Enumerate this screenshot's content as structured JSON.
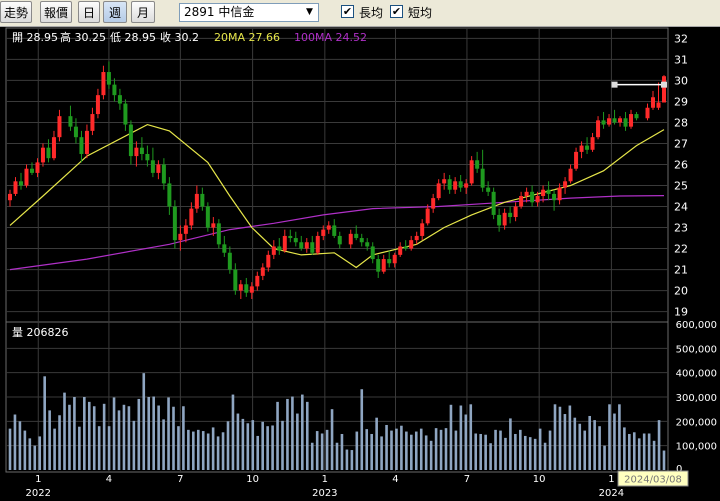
{
  "toolbar": {
    "buttons": [
      {
        "label": "走勢",
        "active": false
      },
      {
        "label": "報價",
        "active": false
      },
      {
        "label": "日",
        "active": false
      },
      {
        "label": "週",
        "active": true
      },
      {
        "label": "月",
        "active": false
      }
    ],
    "stock_select": "2891 中信金",
    "checkboxes": [
      {
        "label": "長均",
        "checked": true
      },
      {
        "label": "短均",
        "checked": true
      }
    ]
  },
  "colors": {
    "up": "#ff2a2a",
    "down": "#1f9a1f",
    "ma20": "#e6e64a",
    "ma100": "#b030c8",
    "volume": "#8fa6c2",
    "grid": "#3a3a3a",
    "highlight": "#ffffc0"
  },
  "info": {
    "open": "開 28.95",
    "high": "高 30.25",
    "low": "低 28.95",
    "close": "收 30.2",
    "ma20": "20MA 27.66",
    "ma100": "100MA 24.52"
  },
  "volume_label": "量 206826",
  "chart_data": [
    {
      "type": "candlestick",
      "title": "",
      "ylim": [
        18.6,
        32.4
      ],
      "y_ticks": [
        19,
        20,
        21,
        22,
        23,
        24,
        25,
        26,
        27,
        28,
        29,
        30,
        31,
        32
      ],
      "grid": true,
      "series": [
        {
          "name": "20MA",
          "values_by_date": [
            [
              "2021-11-26",
              23.1
            ],
            [
              "2022-01-07",
              24.5
            ],
            [
              "2022-03-04",
              26.4
            ],
            [
              "2022-05-20",
              27.9
            ],
            [
              "2022-06-17",
              27.6
            ],
            [
              "2022-08-05",
              26.1
            ],
            [
              "2022-09-02",
              24.5
            ],
            [
              "2022-09-30",
              23.0
            ],
            [
              "2022-10-28",
              22.0
            ],
            [
              "2022-12-02",
              21.7
            ],
            [
              "2023-01-13",
              21.8
            ],
            [
              "2023-02-10",
              21.1
            ],
            [
              "2023-03-03",
              21.7
            ],
            [
              "2023-04-28",
              22.2
            ],
            [
              "2023-06-02",
              23.0
            ],
            [
              "2023-07-07",
              23.6
            ],
            [
              "2023-08-18",
              24.2
            ],
            [
              "2023-09-29",
              24.6
            ],
            [
              "2023-11-10",
              25.0
            ],
            [
              "2023-12-22",
              25.7
            ],
            [
              "2024-02-02",
              26.9
            ],
            [
              "2024-03-08",
              27.66
            ]
          ]
        },
        {
          "name": "100MA",
          "values_by_date": [
            [
              "2021-11-26",
              21.0
            ],
            [
              "2022-03-04",
              21.5
            ],
            [
              "2022-06-17",
              22.2
            ],
            [
              "2022-09-02",
              22.9
            ],
            [
              "2022-10-28",
              23.2
            ],
            [
              "2022-12-30",
              23.6
            ],
            [
              "2023-03-03",
              23.9
            ],
            [
              "2023-05-26",
              24.0
            ],
            [
              "2023-08-18",
              24.2
            ],
            [
              "2023-11-10",
              24.4
            ],
            [
              "2024-01-12",
              24.5
            ],
            [
              "2024-03-08",
              24.52
            ]
          ]
        }
      ],
      "candles": [
        [
          "2021-11-26",
          24.3,
          24.8,
          24.0,
          24.6
        ],
        [
          "2021-12-03",
          24.6,
          25.4,
          24.5,
          25.2
        ],
        [
          "2021-12-10",
          25.2,
          25.6,
          24.8,
          25.0
        ],
        [
          "2021-12-17",
          25.0,
          26.0,
          24.9,
          25.8
        ],
        [
          "2021-12-24",
          25.8,
          26.1,
          25.5,
          25.6
        ],
        [
          "2021-12-31",
          25.6,
          26.3,
          25.4,
          26.1
        ],
        [
          "2022-01-07",
          26.1,
          27.0,
          25.9,
          26.8
        ],
        [
          "2022-01-14",
          26.8,
          27.2,
          26.1,
          26.3
        ],
        [
          "2022-01-21",
          26.3,
          27.6,
          26.2,
          27.3
        ],
        [
          "2022-01-28",
          27.3,
          28.6,
          27.1,
          28.3
        ],
        [
          "2022-02-11",
          28.3,
          28.8,
          27.6,
          27.8
        ],
        [
          "2022-02-18",
          27.8,
          28.2,
          27.0,
          27.3
        ],
        [
          "2022-02-25",
          27.3,
          27.6,
          26.1,
          26.5
        ],
        [
          "2022-03-04",
          26.5,
          27.9,
          26.3,
          27.6
        ],
        [
          "2022-03-11",
          27.6,
          28.7,
          27.4,
          28.4
        ],
        [
          "2022-03-18",
          28.4,
          29.6,
          28.2,
          29.3
        ],
        [
          "2022-03-25",
          29.3,
          30.7,
          29.1,
          30.4
        ],
        [
          "2022-04-01",
          30.4,
          30.9,
          29.6,
          29.8
        ],
        [
          "2022-04-08",
          29.8,
          30.1,
          29.0,
          29.3
        ],
        [
          "2022-04-15",
          29.3,
          29.6,
          28.6,
          28.9
        ],
        [
          "2022-04-22",
          28.9,
          29.1,
          27.6,
          27.9
        ],
        [
          "2022-04-29",
          27.9,
          28.1,
          26.0,
          26.4
        ],
        [
          "2022-05-06",
          26.4,
          27.1,
          25.9,
          26.8
        ],
        [
          "2022-05-13",
          26.8,
          27.3,
          26.2,
          26.5
        ],
        [
          "2022-05-20",
          26.5,
          26.9,
          25.9,
          26.2
        ],
        [
          "2022-05-27",
          26.2,
          26.8,
          25.4,
          25.6
        ],
        [
          "2022-06-03",
          25.6,
          26.2,
          25.3,
          26.0
        ],
        [
          "2022-06-10",
          26.0,
          26.3,
          24.8,
          25.1
        ],
        [
          "2022-06-17",
          25.1,
          25.4,
          23.6,
          24.0
        ],
        [
          "2022-06-24",
          24.0,
          24.3,
          22.0,
          22.4
        ],
        [
          "2022-07-01",
          22.4,
          23.1,
          21.9,
          22.7
        ],
        [
          "2022-07-08",
          22.7,
          23.4,
          22.3,
          23.1
        ],
        [
          "2022-07-15",
          23.1,
          24.2,
          22.9,
          23.9
        ],
        [
          "2022-07-22",
          23.9,
          25.0,
          23.7,
          24.6
        ],
        [
          "2022-07-29",
          24.6,
          24.9,
          23.8,
          24.0
        ],
        [
          "2022-08-05",
          24.0,
          24.2,
          22.8,
          23.0
        ],
        [
          "2022-08-12",
          23.0,
          23.5,
          22.6,
          23.2
        ],
        [
          "2022-08-19",
          23.2,
          23.4,
          22.0,
          22.2
        ],
        [
          "2022-08-26",
          22.2,
          22.6,
          21.6,
          21.8
        ],
        [
          "2022-09-02",
          21.8,
          22.1,
          20.8,
          21.0
        ],
        [
          "2022-09-09",
          21.0,
          21.3,
          19.8,
          20.0
        ],
        [
          "2022-09-16",
          20.0,
          20.5,
          19.6,
          20.3
        ],
        [
          "2022-09-23",
          20.3,
          20.6,
          19.7,
          19.9
        ],
        [
          "2022-09-30",
          19.9,
          20.4,
          19.6,
          20.2
        ],
        [
          "2022-10-07",
          20.2,
          20.9,
          20.0,
          20.7
        ],
        [
          "2022-10-14",
          20.7,
          21.3,
          20.5,
          21.1
        ],
        [
          "2022-10-21",
          21.1,
          21.9,
          20.9,
          21.7
        ],
        [
          "2022-10-28",
          21.7,
          22.4,
          21.5,
          22.1
        ],
        [
          "2022-11-04",
          22.1,
          22.5,
          21.7,
          21.9
        ],
        [
          "2022-11-11",
          21.9,
          22.9,
          21.8,
          22.6
        ],
        [
          "2022-11-18",
          22.6,
          22.9,
          22.3,
          22.5
        ],
        [
          "2022-11-25",
          22.5,
          22.8,
          22.1,
          22.3
        ],
        [
          "2022-12-02",
          22.3,
          22.6,
          21.9,
          22.0
        ],
        [
          "2022-12-09",
          22.0,
          22.5,
          21.8,
          22.3
        ],
        [
          "2022-12-16",
          22.3,
          22.6,
          21.7,
          21.8
        ],
        [
          "2022-12-23",
          21.8,
          22.8,
          21.7,
          22.6
        ],
        [
          "2022-12-30",
          22.6,
          23.1,
          22.4,
          22.9
        ],
        [
          "2023-01-06",
          22.9,
          23.3,
          22.7,
          23.1
        ],
        [
          "2023-01-13",
          23.1,
          23.4,
          22.5,
          22.6
        ],
        [
          "2023-01-20",
          22.6,
          22.8,
          22.0,
          22.2
        ],
        [
          "2023-02-03",
          22.2,
          22.9,
          22.0,
          22.7
        ],
        [
          "2023-02-10",
          22.7,
          23.1,
          22.4,
          22.5
        ],
        [
          "2023-02-17",
          22.5,
          22.7,
          22.1,
          22.3
        ],
        [
          "2023-02-24",
          22.3,
          22.5,
          21.9,
          22.1
        ],
        [
          "2023-03-03",
          22.1,
          22.3,
          21.3,
          21.5
        ],
        [
          "2023-03-10",
          21.5,
          21.7,
          20.6,
          20.9
        ],
        [
          "2023-03-17",
          20.9,
          21.7,
          20.8,
          21.5
        ],
        [
          "2023-03-24",
          21.5,
          21.9,
          21.1,
          21.3
        ],
        [
          "2023-03-31",
          21.3,
          21.8,
          21.1,
          21.7
        ],
        [
          "2023-04-07",
          21.7,
          22.3,
          21.6,
          22.1
        ],
        [
          "2023-04-14",
          22.1,
          22.4,
          21.9,
          22.0
        ],
        [
          "2023-04-21",
          22.0,
          22.6,
          21.9,
          22.4
        ],
        [
          "2023-04-28",
          22.4,
          22.8,
          22.2,
          22.6
        ],
        [
          "2023-05-05",
          22.6,
          23.4,
          22.4,
          23.2
        ],
        [
          "2023-05-12",
          23.2,
          24.1,
          23.1,
          23.9
        ],
        [
          "2023-05-19",
          23.9,
          24.6,
          23.7,
          24.4
        ],
        [
          "2023-05-26",
          24.4,
          25.3,
          24.3,
          25.1
        ],
        [
          "2023-06-02",
          25.1,
          25.6,
          24.8,
          25.3
        ],
        [
          "2023-06-09",
          25.3,
          25.5,
          24.6,
          24.8
        ],
        [
          "2023-06-16",
          24.8,
          25.4,
          24.6,
          25.2
        ],
        [
          "2023-06-23",
          25.2,
          25.5,
          24.7,
          24.9
        ],
        [
          "2023-06-30",
          24.9,
          25.3,
          24.6,
          25.1
        ],
        [
          "2023-07-07",
          25.1,
          26.4,
          25.0,
          26.2
        ],
        [
          "2023-07-14",
          26.2,
          26.6,
          25.6,
          25.8
        ],
        [
          "2023-07-21",
          25.8,
          26.7,
          24.7,
          24.9
        ],
        [
          "2023-07-28",
          24.9,
          25.2,
          24.5,
          24.7
        ],
        [
          "2023-08-04",
          24.7,
          24.9,
          23.4,
          23.6
        ],
        [
          "2023-08-11",
          23.6,
          23.9,
          22.8,
          23.1
        ],
        [
          "2023-08-18",
          23.1,
          23.9,
          22.9,
          23.7
        ],
        [
          "2023-08-25",
          23.7,
          24.0,
          23.2,
          23.5
        ],
        [
          "2023-09-01",
          23.5,
          24.2,
          23.3,
          24.0
        ],
        [
          "2023-09-08",
          24.0,
          24.7,
          23.9,
          24.5
        ],
        [
          "2023-09-15",
          24.5,
          24.9,
          24.2,
          24.7
        ],
        [
          "2023-09-22",
          24.7,
          25.0,
          24.0,
          24.2
        ],
        [
          "2023-09-29",
          24.2,
          24.7,
          24.0,
          24.5
        ],
        [
          "2023-10-06",
          24.5,
          25.0,
          24.2,
          24.8
        ],
        [
          "2023-10-13",
          24.8,
          25.2,
          24.3,
          24.6
        ],
        [
          "2023-10-20",
          24.6,
          24.8,
          23.8,
          24.3
        ],
        [
          "2023-10-27",
          24.3,
          25.1,
          24.1,
          24.9
        ],
        [
          "2023-11-03",
          24.9,
          25.4,
          24.6,
          25.2
        ],
        [
          "2023-11-10",
          25.2,
          26.0,
          25.1,
          25.8
        ],
        [
          "2023-11-17",
          25.8,
          26.8,
          25.7,
          26.6
        ],
        [
          "2023-11-24",
          26.6,
          27.1,
          26.3,
          26.9
        ],
        [
          "2023-12-01",
          26.9,
          27.3,
          26.5,
          26.7
        ],
        [
          "2023-12-08",
          26.7,
          27.5,
          26.6,
          27.3
        ],
        [
          "2023-12-15",
          27.3,
          28.3,
          27.2,
          28.1
        ],
        [
          "2023-12-22",
          28.1,
          28.5,
          27.7,
          27.9
        ],
        [
          "2023-12-29",
          27.9,
          28.4,
          27.8,
          28.2
        ],
        [
          "2024-01-05",
          28.2,
          28.6,
          27.9,
          28.0
        ],
        [
          "2024-01-12",
          28.0,
          28.3,
          27.8,
          28.2
        ],
        [
          "2024-01-19",
          28.2,
          28.5,
          27.6,
          27.8
        ],
        [
          "2024-01-26",
          27.8,
          28.6,
          27.7,
          28.4
        ],
        [
          "2024-02-02",
          28.4,
          28.5,
          28.1,
          28.2
        ],
        [
          "2024-02-16",
          28.2,
          28.9,
          28.1,
          28.7
        ],
        [
          "2024-02-23",
          28.7,
          29.5,
          28.6,
          29.2
        ],
        [
          "2024-03-01",
          28.7,
          29.9,
          28.6,
          28.95
        ],
        [
          "2024-03-08",
          28.95,
          30.25,
          28.95,
          30.2
        ]
      ],
      "price_annotation": {
        "from_date": "2024-01-05",
        "to_date": "2024-03-08",
        "value": 29.8
      }
    },
    {
      "type": "bar",
      "title": "",
      "ylim": [
        0,
        600000
      ],
      "y_ticks": [
        "0",
        "100,000",
        "200,000",
        "300,000",
        "400,000",
        "500,000",
        "600,000"
      ],
      "values": [
        170000,
        228000,
        200000,
        162000,
        130000,
        100000,
        138000,
        385000,
        245000,
        170000,
        225000,
        318000,
        268000,
        300000,
        178000,
        300000,
        280000,
        262000,
        180000,
        272000,
        180000,
        298000,
        245000,
        268000,
        262000,
        202000,
        292000,
        398000,
        300000,
        302000,
        265000,
        208000,
        298000,
        260000,
        180000,
        262000,
        165000,
        158000,
        165000,
        160000,
        150000,
        175000,
        138000,
        155000,
        200000,
        310000,
        232000,
        210000,
        192000,
        205000,
        140000,
        198000,
        180000,
        183000,
        280000,
        202000,
        292000,
        302000,
        232000,
        310000,
        280000,
        112000,
        160000,
        150000,
        165000,
        250000,
        112000,
        148000,
        84000,
        82000,
        158000,
        332000,
        168000,
        148000,
        215000,
        138000,
        185000,
        162000,
        170000,
        182000,
        158000,
        145000,
        158000,
        170000,
        142000,
        120000,
        172000,
        165000,
        172000,
        268000,
        162000,
        265000,
        228000,
        270000,
        150000,
        148000,
        145000,
        110000,
        165000,
        162000,
        132000,
        212000,
        148000,
        165000,
        140000,
        135000,
        128000,
        170000,
        112000,
        162000,
        270000,
        260000,
        230000,
        265000,
        215000,
        190000,
        162000,
        222000,
        205000,
        180000,
        100000,
        270000,
        232000,
        270000,
        175000,
        148000,
        155000,
        130000,
        150000,
        150000,
        120000,
        205000,
        80000
      ],
      "x_tick_labels": [
        "1",
        "4",
        "7",
        "10",
        "1",
        "4",
        "7",
        "10",
        "1"
      ],
      "year_labels": [
        "2022",
        "2023",
        "2024"
      ],
      "cursor_date": "2024/03/08"
    }
  ]
}
